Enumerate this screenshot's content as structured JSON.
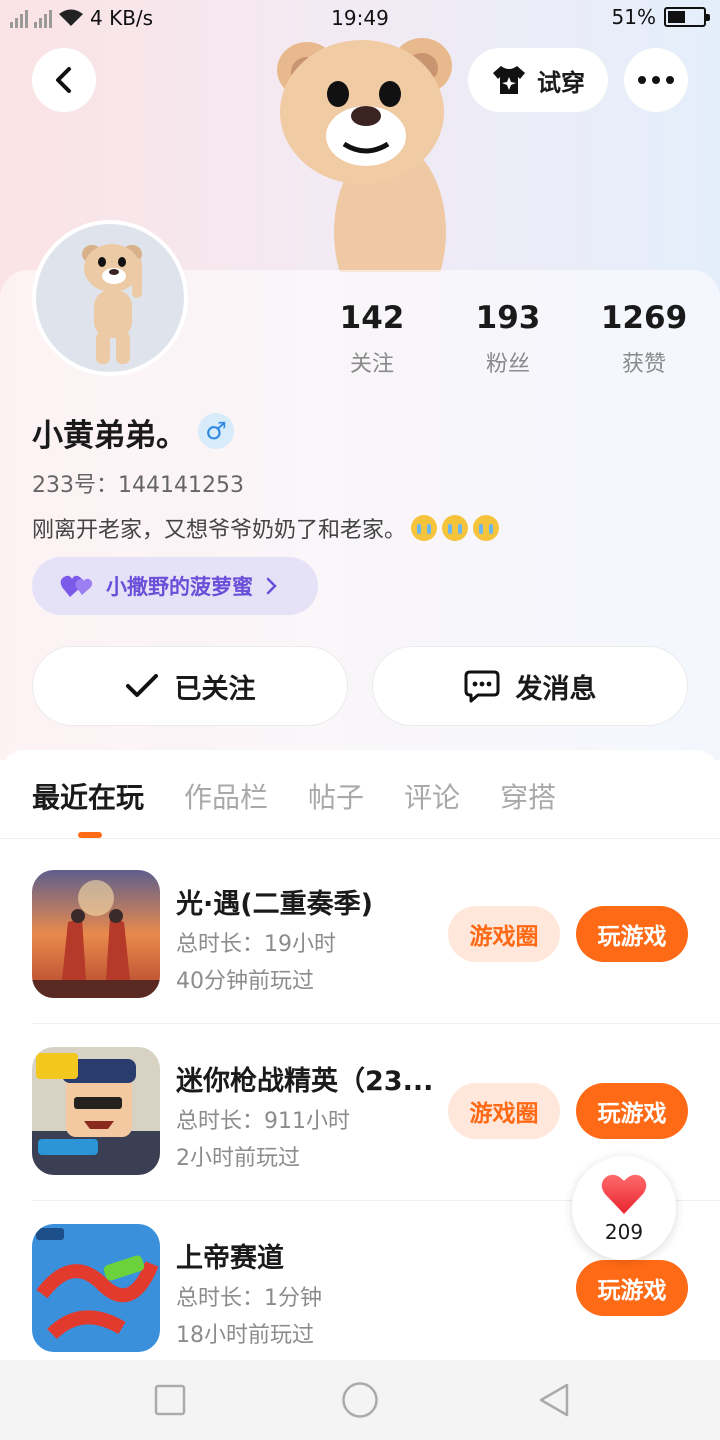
{
  "status_bar": {
    "network_speed": "4 KB/s",
    "time": "19:49",
    "battery": "51%",
    "battery_level": 0.51
  },
  "header": {
    "back_icon": "chevron-left-icon",
    "try_on_label": "试穿",
    "try_on_icon": "tshirt-sparkle-icon",
    "more_icon": "more-dots-icon"
  },
  "profile": {
    "stats": [
      {
        "value": "142",
        "label": "关注"
      },
      {
        "value": "193",
        "label": "粉丝"
      },
      {
        "value": "1269",
        "label": "获赞"
      }
    ],
    "nickname": "小黄弟弟。",
    "gender_icon": "male-icon",
    "gender_symbol": "♂",
    "uid": "233号：144141253",
    "bio": "刚离开老家，又想爷爷奶奶了和老家。",
    "bio_emojis": [
      "crying-face",
      "crying-face",
      "crying-face"
    ],
    "fan_club": "小撒野的菠萝蜜",
    "follow_button": "已关注",
    "message_button": "发消息"
  },
  "tabs": [
    {
      "label": "最近在玩",
      "active": true
    },
    {
      "label": "作品栏",
      "active": false
    },
    {
      "label": "帖子",
      "active": false
    },
    {
      "label": "评论",
      "active": false
    },
    {
      "label": "穿搭",
      "active": false
    }
  ],
  "games": [
    {
      "title": "光·遇(二重奏季)",
      "duration": "总时长：19小时",
      "last_played": "40分钟前玩过",
      "circle_label": "游戏圈",
      "play_label": "玩游戏"
    },
    {
      "title": "迷你枪战精英（23...",
      "duration": "总时长：911小时",
      "last_played": "2小时前玩过",
      "circle_label": "游戏圈",
      "play_label": "玩游戏"
    },
    {
      "title": "上帝赛道",
      "duration": "总时长：1分钟",
      "last_played": "18小时前玩过",
      "play_label": "玩游戏"
    }
  ],
  "like_bubble": {
    "count": "209",
    "icon": "heart-icon"
  },
  "colors": {
    "accent": "#ff6a16",
    "accent_light": "#ffe8db",
    "fan_club_text": "#6a4fd9",
    "fan_club_bg": "#e5e2f7"
  }
}
